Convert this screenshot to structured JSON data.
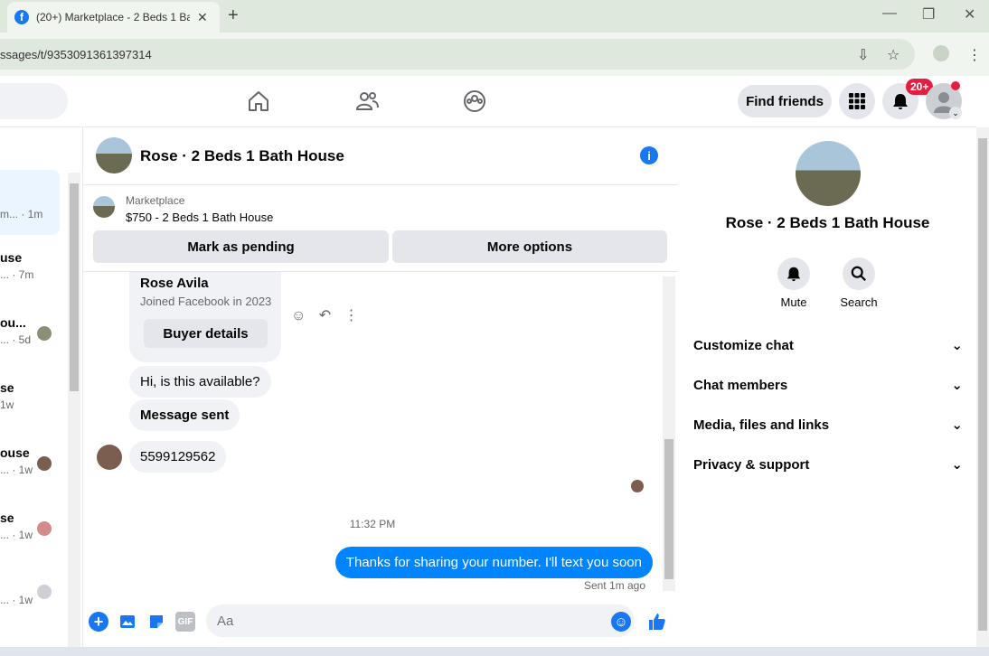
{
  "browser": {
    "tab_title": "(20+) Marketplace - 2 Beds 1 Ba",
    "url": "ssages/t/9353091361397314"
  },
  "header": {
    "find_friends": "Find friends",
    "notification_count": "20+"
  },
  "left_list": {
    "items": [
      {
        "line1": "",
        "line2": "m... · 1m"
      },
      {
        "line1": "use",
        "line2": "... · 7m"
      },
      {
        "line1": "ou...",
        "line2": "... · 5d"
      },
      {
        "line1": "se",
        "line2": "1w"
      },
      {
        "line1": "ouse",
        "line2": "... · 1w"
      },
      {
        "line1": "se",
        "line2": "... · 1w"
      },
      {
        "line1": "",
        "line2": "... · 1w"
      }
    ]
  },
  "chat": {
    "title": "Rose · 2 Beds 1 Bath House",
    "marketplace_label": "Marketplace",
    "listing": "$750 - 2 Beds 1 Bath House",
    "mark_pending": "Mark as pending",
    "more_options": "More options",
    "profile": {
      "name": "Rose Avila",
      "joined": "Joined Facebook in 2023",
      "buyer_details": "Buyer details"
    },
    "incoming": [
      "Hi, is this available?",
      "Message sent",
      "5599129562"
    ],
    "timestamp": "11:32 PM",
    "outgoing": "Thanks for sharing your number. I'll text you soon",
    "sent_status": "Sent 1m ago",
    "composer_placeholder": "Aa",
    "gif_label": "GIF"
  },
  "right_panel": {
    "title": "Rose · 2 Beds 1 Bath House",
    "mute": "Mute",
    "search": "Search",
    "sections": [
      "Customize chat",
      "Chat members",
      "Media, files and links",
      "Privacy & support"
    ]
  },
  "colors": {
    "accent": "#0084ff",
    "fb_blue": "#1877f2",
    "badge": "#e41e3f"
  }
}
